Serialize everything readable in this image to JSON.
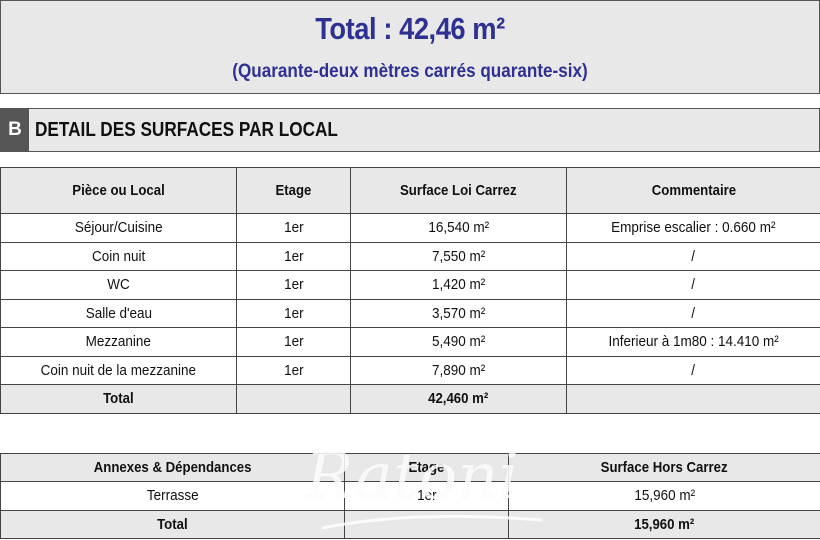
{
  "summary": {
    "total_label": "Total : 42,46 m²",
    "total_words": "(Quarante-deux mètres carrés quarante-six)"
  },
  "section": {
    "letter": "B",
    "title": "DETAIL DES SURFACES PAR LOCAL"
  },
  "main_table": {
    "headers": [
      "Pièce ou Local",
      "Etage",
      "Surface Loi Carrez",
      "Commentaire"
    ],
    "rows": [
      [
        "Séjour/Cuisine",
        "1er",
        "16,540 m²",
        "Emprise escalier : 0.660 m²"
      ],
      [
        "Coin nuit",
        "1er",
        "7,550 m²",
        "/"
      ],
      [
        "WC",
        "1er",
        "1,420 m²",
        "/"
      ],
      [
        "Salle d'eau",
        "1er",
        "3,570 m²",
        "/"
      ],
      [
        "Mezzanine",
        "1er",
        "5,490 m²",
        "Inferieur à 1m80 : 14.410 m²"
      ],
      [
        "Coin nuit de la mezzanine",
        "1er",
        "7,890 m²",
        "/"
      ]
    ],
    "total": [
      "Total",
      "",
      "42,460 m²",
      ""
    ]
  },
  "annex_table": {
    "headers": [
      "Annexes & Dépendances",
      "Etage",
      "Surface Hors Carrez"
    ],
    "rows": [
      [
        "Terrasse",
        "1er",
        "15,960 m²"
      ]
    ],
    "total": [
      "Total",
      "",
      "15,960 m²"
    ]
  },
  "watermark": {
    "text": "Ratoni"
  }
}
